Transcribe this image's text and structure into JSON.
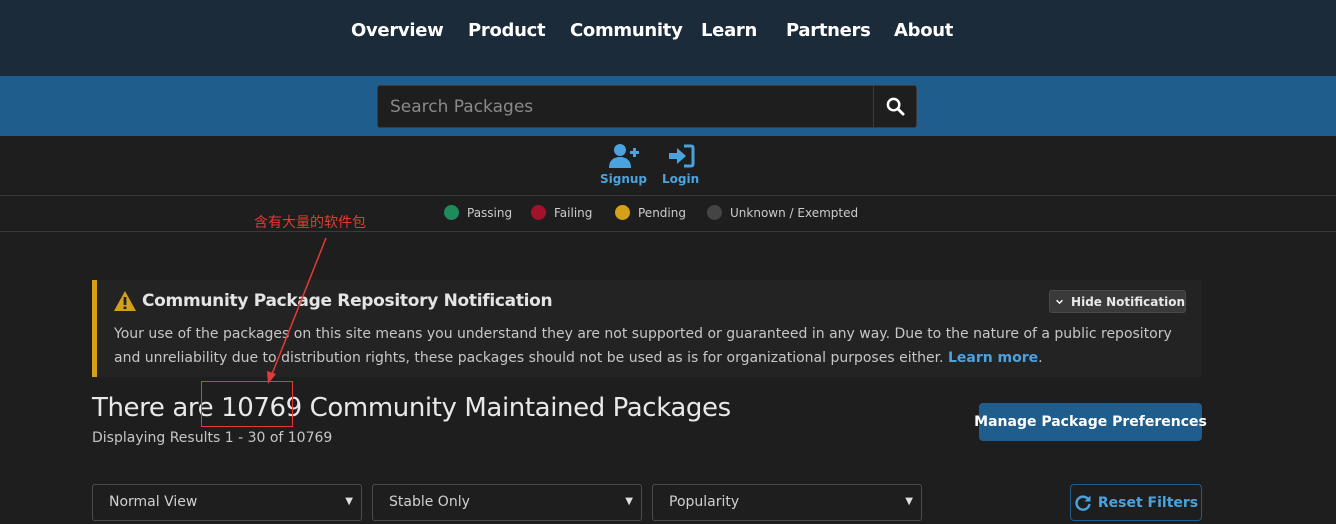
{
  "nav": {
    "items": [
      {
        "label": "Overview"
      },
      {
        "label": "Product"
      },
      {
        "label": "Community"
      },
      {
        "label": "Learn"
      },
      {
        "label": "Partners"
      },
      {
        "label": "About"
      }
    ]
  },
  "search": {
    "placeholder": "Search Packages",
    "value": ""
  },
  "auth": {
    "signup": "Signup",
    "login": "Login"
  },
  "legend": {
    "items": [
      {
        "label": "Passing",
        "color": "#1f8a5b"
      },
      {
        "label": "Failing",
        "color": "#a3122a"
      },
      {
        "label": "Pending",
        "color": "#d4a017"
      },
      {
        "label": "Unknown / Exempted",
        "color": "#444444"
      }
    ]
  },
  "annotation": {
    "text": "含有大量的软件包"
  },
  "notification": {
    "title": "Community Package Repository Notification",
    "body": "Your use of the packages on this site means you understand they are not supported or guaranteed in any way. Due to the nature of a public repository and unreliability due to distribution rights, these packages should not be used as is for organizational purposes either.",
    "link": "Learn more",
    "trailing": ".",
    "hide_label": "Hide Notification"
  },
  "summary": {
    "prefix": "There are",
    "count": "10769",
    "suffix": "Community Maintained Packages",
    "results": "Displaying Results 1 - 30 of 10769"
  },
  "actions": {
    "manage": "Manage Package Preferences",
    "reset": "Reset Filters"
  },
  "filters": {
    "view": "Normal View",
    "stability": "Stable Only",
    "sort": "Popularity"
  },
  "colors": {
    "nav_bg": "#1c2b39",
    "accent": "#1f5d8c",
    "link": "#4aa3df",
    "warning": "#d4a017",
    "annotation": "#e53935"
  }
}
